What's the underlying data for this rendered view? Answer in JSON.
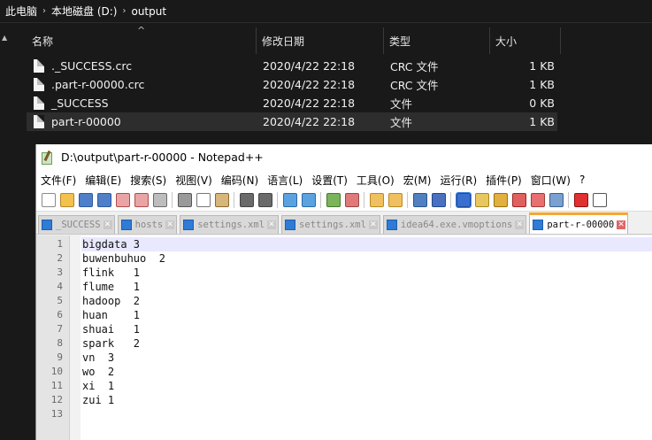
{
  "explorer": {
    "breadcrumb": [
      "此电脑",
      "本地磁盘 (D:)",
      "output"
    ],
    "columns": {
      "name": "名称",
      "date": "修改日期",
      "type": "类型",
      "size": "大小"
    },
    "files": [
      {
        "name": "._SUCCESS.crc",
        "date": "2020/4/22 22:18",
        "type": "CRC 文件",
        "size": "1 KB"
      },
      {
        "name": ".part-r-00000.crc",
        "date": "2020/4/22 22:18",
        "type": "CRC 文件",
        "size": "1 KB"
      },
      {
        "name": "_SUCCESS",
        "date": "2020/4/22 22:18",
        "type": "文件",
        "size": "0 KB"
      },
      {
        "name": "part-r-00000",
        "date": "2020/4/22 22:18",
        "type": "文件",
        "size": "1 KB"
      }
    ]
  },
  "notepad": {
    "title": "D:\\output\\part-r-00000 - Notepad++",
    "menu": [
      "文件(F)",
      "编辑(E)",
      "搜索(S)",
      "视图(V)",
      "编码(N)",
      "语言(L)",
      "设置(T)",
      "工具(O)",
      "宏(M)",
      "运行(R)",
      "插件(P)",
      "窗口(W)",
      "?"
    ],
    "tabs": [
      {
        "label": "_SUCCESS",
        "active": false
      },
      {
        "label": "hosts",
        "active": false
      },
      {
        "label": "settings.xml",
        "active": false
      },
      {
        "label": "settings.xml",
        "active": false
      },
      {
        "label": "idea64.exe.vmoptions",
        "active": false
      },
      {
        "label": "part-r-00000",
        "active": true
      }
    ],
    "lines": [
      {
        "num": "1",
        "text": "bigdata 3"
      },
      {
        "num": "2",
        "text": "buwenbuhuo  2"
      },
      {
        "num": "3",
        "text": "flink   1"
      },
      {
        "num": "4",
        "text": "flume   1"
      },
      {
        "num": "5",
        "text": "hadoop  2"
      },
      {
        "num": "6",
        "text": "huan    1"
      },
      {
        "num": "7",
        "text": "shuai   1"
      },
      {
        "num": "8",
        "text": "spark   2"
      },
      {
        "num": "9",
        "text": "vn  3"
      },
      {
        "num": "10",
        "text": "wo  2"
      },
      {
        "num": "11",
        "text": "xi  1"
      },
      {
        "num": "12",
        "text": "zui 1"
      },
      {
        "num": "13",
        "text": ""
      }
    ]
  },
  "colors": {
    "explorer_bg": "#191919",
    "selection": "#2d2d2d",
    "current_line": "#e8e8ff",
    "active_tab_accent": "#f5a733"
  }
}
